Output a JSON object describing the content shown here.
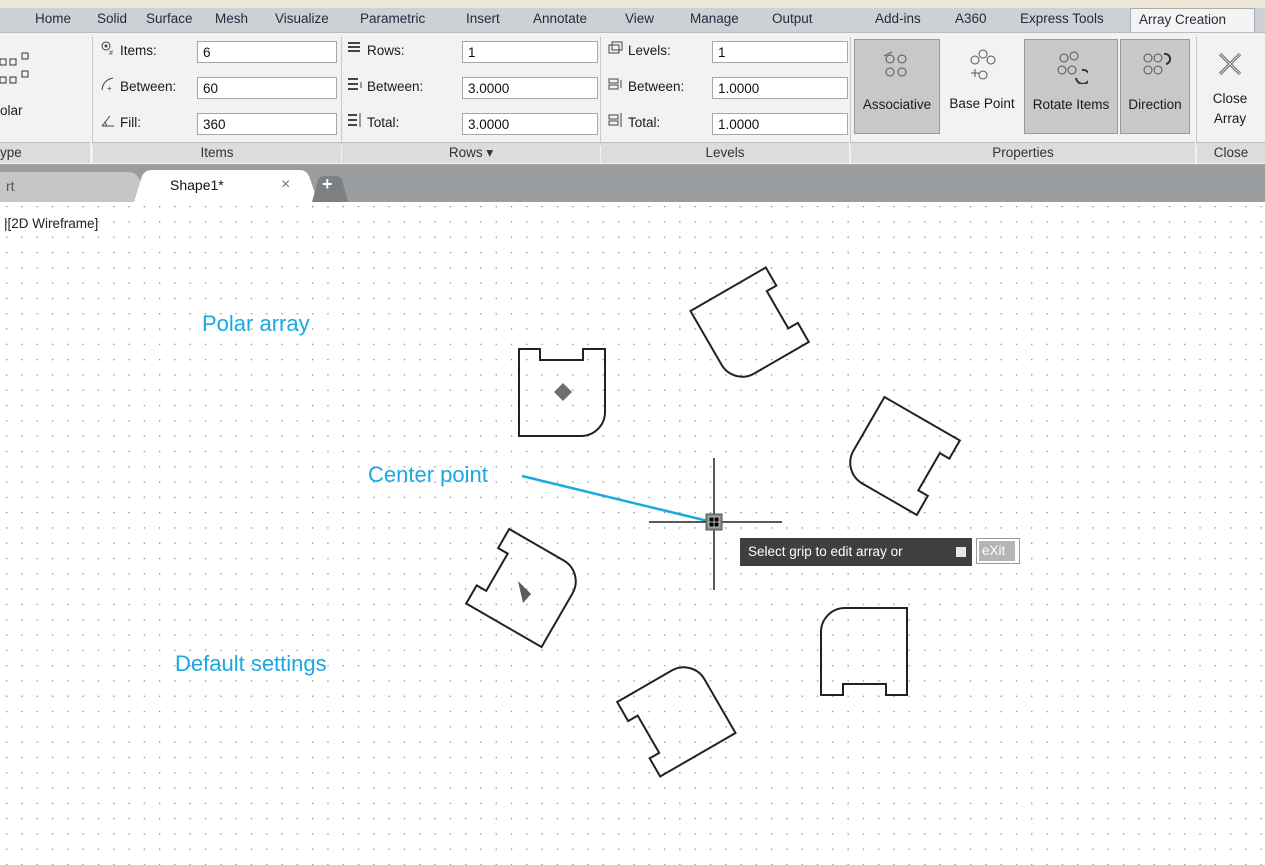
{
  "menu_tabs": [
    "Home",
    "Solid",
    "Surface",
    "Mesh",
    "Visualize",
    "Parametric",
    "Insert",
    "Annotate",
    "View",
    "Manage",
    "Output",
    "Add-ins",
    "A360",
    "Express Tools",
    "Array Creation"
  ],
  "active_tab": "Array Creation",
  "type_panel": {
    "button_label": "olar",
    "footer": "ype"
  },
  "items_panel": {
    "footer": "Items",
    "rows": [
      {
        "label": "Items:",
        "value": "6",
        "icon": "items-count-icon"
      },
      {
        "label": "Between:",
        "value": "60",
        "icon": "angle-between-icon"
      },
      {
        "label": "Fill:",
        "value": "360",
        "icon": "fill-angle-icon"
      }
    ]
  },
  "rows_panel": {
    "footer": "Rows ▾",
    "rows": [
      {
        "label": "Rows:",
        "value": "1",
        "icon": "rows-icon"
      },
      {
        "label": "Between:",
        "value": "3.0000",
        "icon": "row-spacing-icon"
      },
      {
        "label": "Total:",
        "value": "3.0000",
        "icon": "row-total-icon"
      }
    ]
  },
  "levels_panel": {
    "footer": "Levels",
    "rows": [
      {
        "label": "Levels:",
        "value": "1",
        "icon": "levels-icon"
      },
      {
        "label": "Between:",
        "value": "1.0000",
        "icon": "level-spacing-icon"
      },
      {
        "label": "Total:",
        "value": "1.0000",
        "icon": "level-total-icon"
      }
    ]
  },
  "properties_panel": {
    "footer": "Properties",
    "buttons": [
      {
        "label": "Associative",
        "active": true
      },
      {
        "label": "Base Point",
        "active": false
      },
      {
        "label": "Rotate Items",
        "active": true
      },
      {
        "label": "Direction",
        "active": true
      }
    ]
  },
  "close_panel": {
    "button_line1": "Close",
    "button_line2": "Array",
    "footer": "Close"
  },
  "doc_tabs": {
    "start": "rt",
    "active": "Shape1*",
    "close": "×",
    "new": "+"
  },
  "viewport_label": "|[2D Wireframe]",
  "annotations": {
    "polar_array": "Polar array",
    "center_point": "Center point",
    "default_settings": "Default settings"
  },
  "command_tooltip": {
    "text": "Select grip to edit array or",
    "option": "eXit"
  },
  "colors": {
    "annotation": "#1ba8e0",
    "ribbon": "#f2f2f2",
    "active_button": "#c8c8c8",
    "tooltip": "#3f3f3f"
  }
}
